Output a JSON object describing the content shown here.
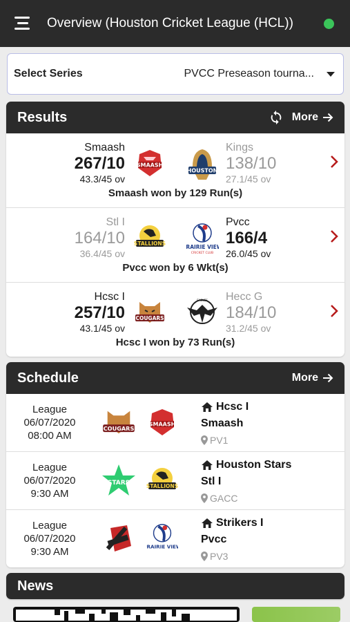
{
  "header": {
    "title": "Overview (Houston Cricket League (HCL))",
    "status_color": "#3bc45a"
  },
  "series": {
    "label": "Select Series",
    "value": "PVCC Preseason tourna..."
  },
  "results": {
    "title": "Results",
    "more": "More",
    "matches": [
      {
        "left": {
          "name": "Smaash",
          "score": "267/10",
          "overs": "43.3/45 ov"
        },
        "right": {
          "name": "Kings",
          "score": "138/10",
          "overs": "27.1/45 ov"
        },
        "winner": "left",
        "result": "Smaash won by 129 Run(s)",
        "left_logo": "smaash-logo",
        "right_logo": "houston-kings-logo"
      },
      {
        "left": {
          "name": "Stl I",
          "score": "164/10",
          "overs": "36.4/45 ov"
        },
        "right": {
          "name": "Pvcc",
          "score": "166/4",
          "overs": "26.0/45 ov"
        },
        "winner": "right",
        "result": "Pvcc won by 6 Wkt(s)",
        "left_logo": "stallions-logo",
        "right_logo": "prairie-view-logo"
      },
      {
        "left": {
          "name": "Hcsc I",
          "score": "257/10",
          "overs": "43.1/45 ov"
        },
        "right": {
          "name": "Hecc G",
          "score": "184/10",
          "overs": "31.2/45 ov"
        },
        "winner": "left",
        "result": "Hcsc I won by 73 Run(s)",
        "left_logo": "cougars-logo",
        "right_logo": "eagles-logo"
      }
    ]
  },
  "schedule": {
    "title": "Schedule",
    "more": "More",
    "items": [
      {
        "type": "League",
        "date": "06/07/2020",
        "time": "08:00 AM",
        "home": "Hcsc I",
        "away": "Smaash",
        "venue": "PV1"
      },
      {
        "type": "League",
        "date": "06/07/2020",
        "time": "9:30 AM",
        "home": "Houston Stars",
        "away": "Stl I",
        "venue": "GACC"
      },
      {
        "type": "League",
        "date": "06/07/2020",
        "time": "9:30 AM",
        "home": "Strikers I",
        "away": "Pvcc",
        "venue": "PV3"
      }
    ]
  },
  "news": {
    "title": "News"
  }
}
